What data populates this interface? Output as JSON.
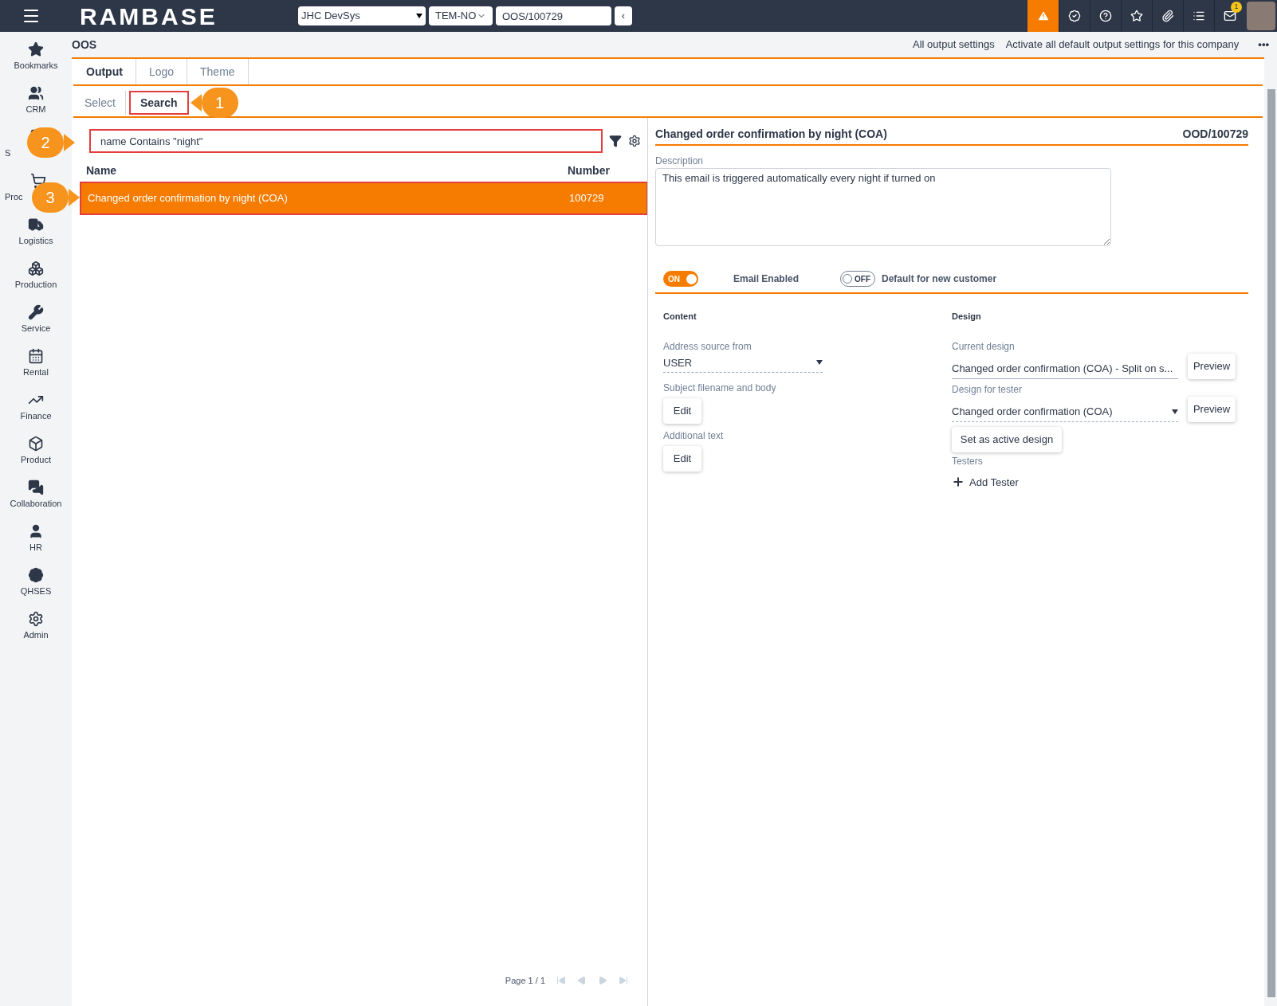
{
  "topbar": {
    "logo": "RAMBASE",
    "company": "JHC DevSys",
    "region": "TEM-NO",
    "document": "OOS/100729",
    "back": "‹",
    "mail_badge": "1"
  },
  "sidebar": {
    "items": [
      {
        "label": "Bookmarks",
        "kind": "star"
      },
      {
        "label": "CRM",
        "kind": "users"
      },
      {
        "label": "S",
        "kind": "sales"
      },
      {
        "label": "Proc",
        "kind": "cart"
      },
      {
        "label": "Logistics",
        "kind": "truck"
      },
      {
        "label": "Production",
        "kind": "boxes"
      },
      {
        "label": "Service",
        "kind": "wrench"
      },
      {
        "label": "Rental",
        "kind": "rental"
      },
      {
        "label": "Finance",
        "kind": "chart"
      },
      {
        "label": "Product",
        "kind": "box"
      },
      {
        "label": "Collaboration",
        "kind": "chat"
      },
      {
        "label": "HR",
        "kind": "user"
      },
      {
        "label": "QHSES",
        "kind": "badge"
      },
      {
        "label": "Admin",
        "kind": "gear"
      }
    ]
  },
  "page": {
    "title": "OOS",
    "actions": [
      "All output settings",
      "Activate all default output settings for this company"
    ],
    "more": "•••"
  },
  "tabs": [
    {
      "label": "Output",
      "selected": true
    },
    {
      "label": "Logo",
      "selected": false
    },
    {
      "label": "Theme",
      "selected": false
    }
  ],
  "subtabs": [
    {
      "label": "Select",
      "selected": false,
      "annotated": false
    },
    {
      "label": "Search",
      "selected": true,
      "annotated": true
    }
  ],
  "search": {
    "value": "name Contains \"night\"",
    "annotated": true
  },
  "table": {
    "columns": [
      "Name",
      "Number"
    ],
    "rows": [
      {
        "name": "Changed order confirmation by night (COA)",
        "number": "100729",
        "selected": true,
        "annotated": true
      }
    ]
  },
  "pager": {
    "label": "Page 1 / 1"
  },
  "callouts": [
    "1",
    "2",
    "3"
  ],
  "detail": {
    "title": "Changed order confirmation by night (COA)",
    "id": "OOD/100729",
    "description_label": "Description",
    "description": "This email is triggered automatically every night if turned on",
    "toggles": [
      {
        "label": "Email Enabled",
        "on": true,
        "text": "ON"
      },
      {
        "label": "Default for new customer",
        "on": false,
        "text": "OFF"
      }
    ],
    "content": {
      "heading": "Content",
      "address_label": "Address source from",
      "address_value": "USER",
      "subject_label": "Subject filename and body",
      "subject_button": "Edit",
      "additional_label": "Additional text",
      "additional_button": "Edit"
    },
    "design": {
      "heading": "Design",
      "current_label": "Current design",
      "current_value": "Changed order confirmation (COA) - Split on s...",
      "preview1": "Preview",
      "tester_label": "Design for tester",
      "tester_value": "Changed order confirmation (COA)",
      "preview2": "Preview",
      "set_active": "Set as active design",
      "testers_label": "Testers",
      "add_tester": "Add Tester"
    }
  }
}
